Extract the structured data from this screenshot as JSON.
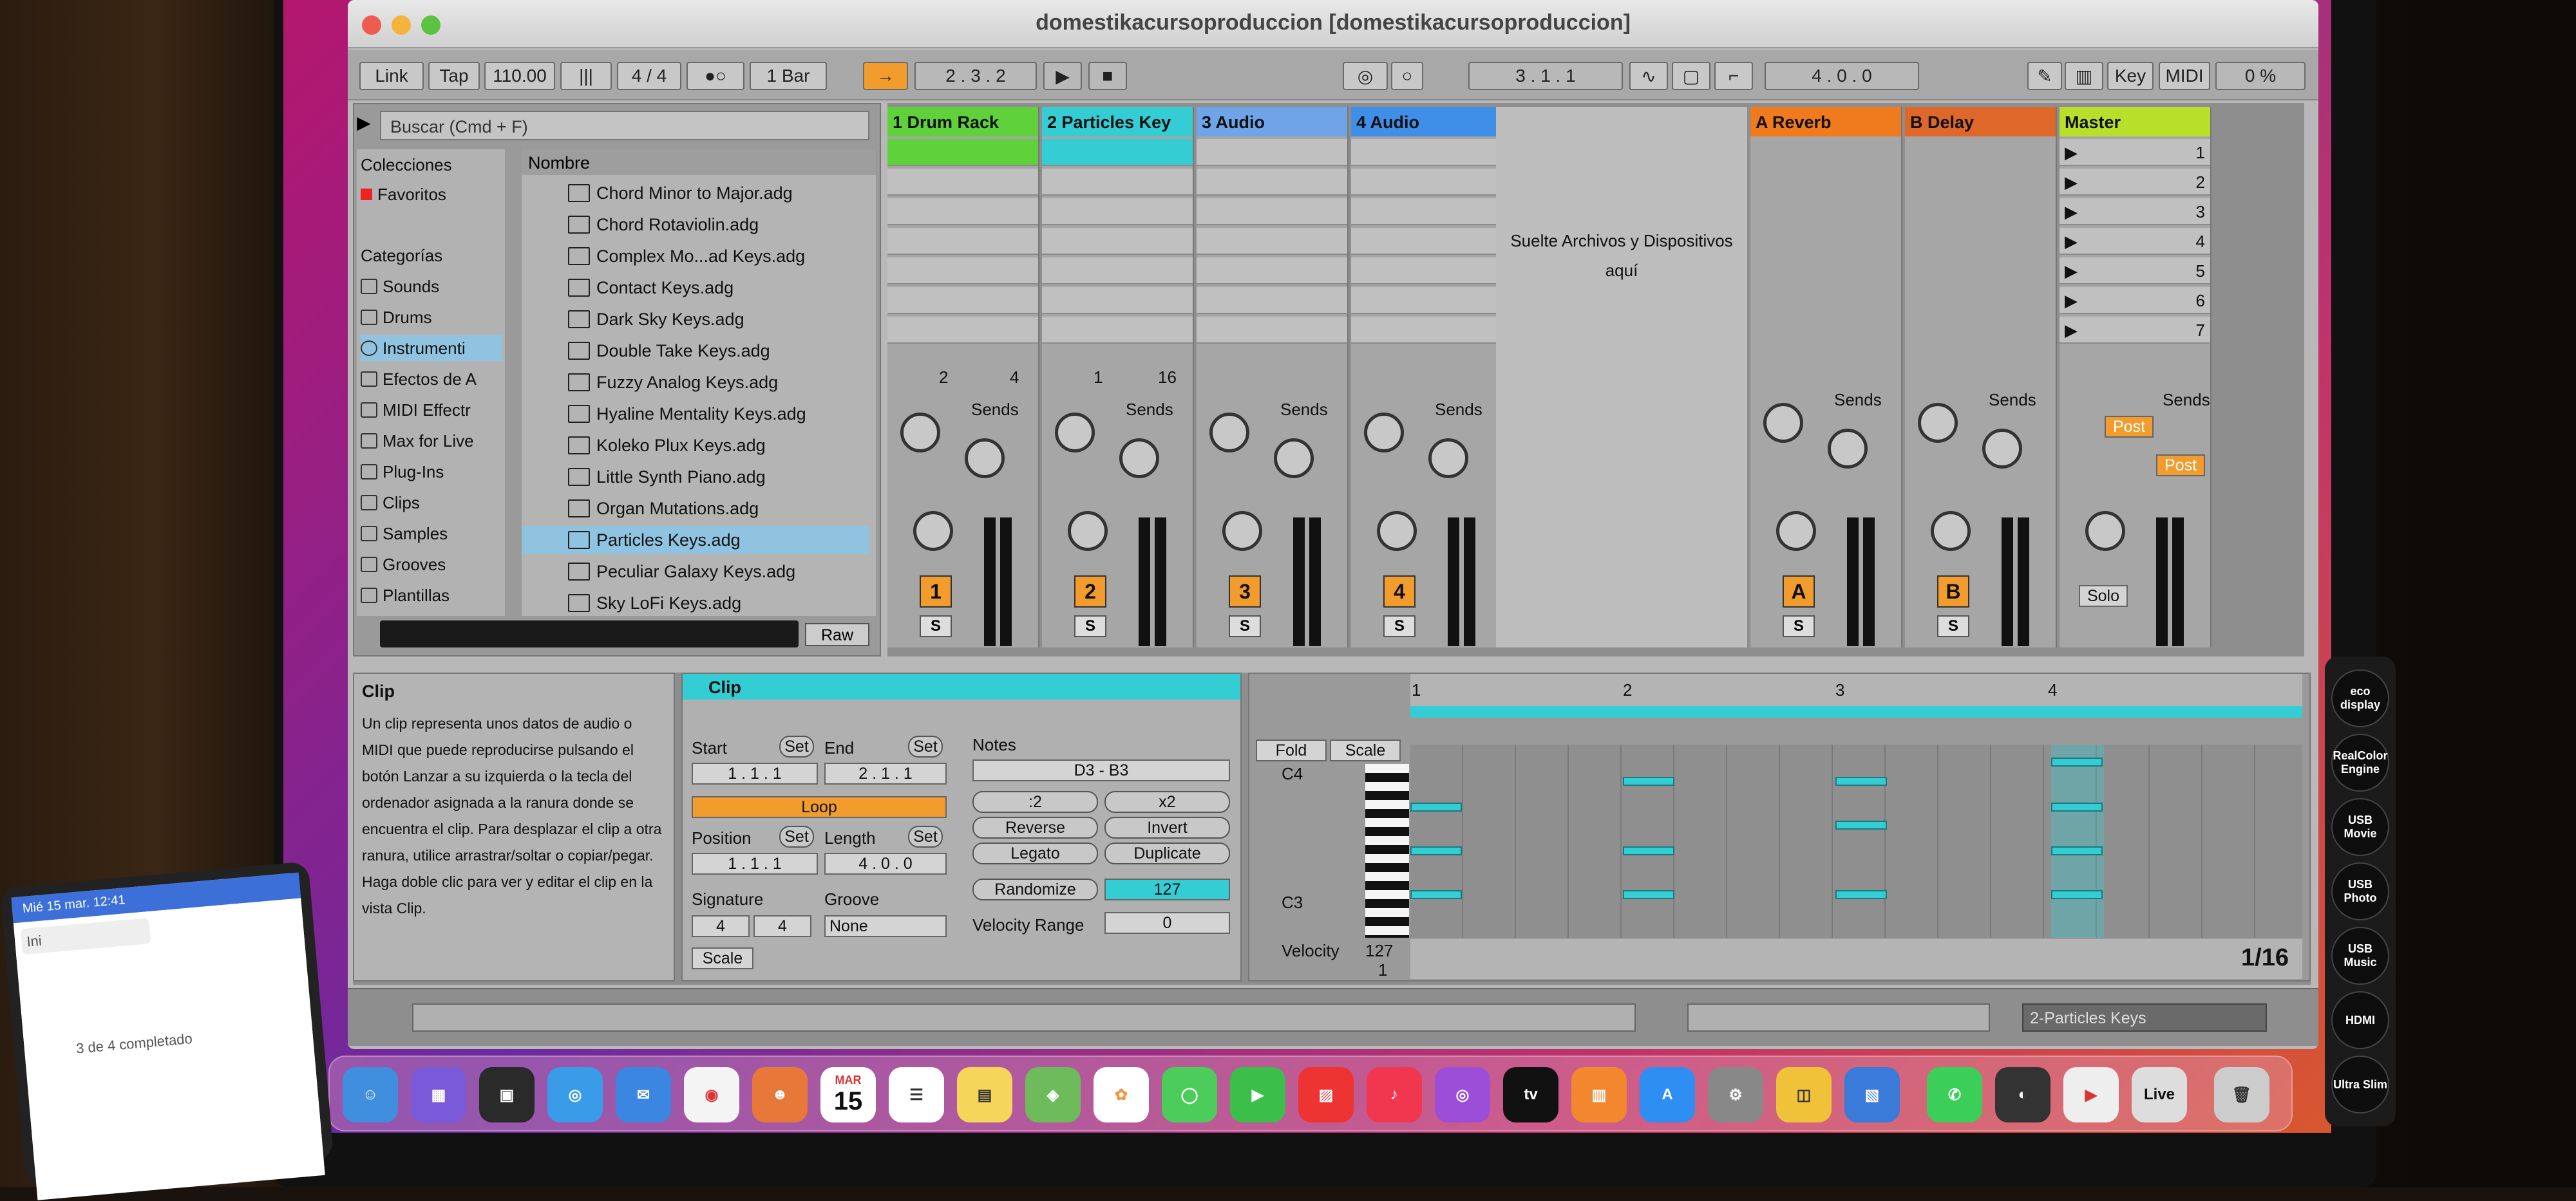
{
  "window": {
    "title": "domestikacursoproduccion  [domestikacursoproduccion]"
  },
  "control_bar": {
    "link": "Link",
    "tap": "Tap",
    "tempo": "110.00",
    "sig": "4 / 4",
    "quant": "1 Bar",
    "pos1": "2 .  3 .  2",
    "pos2": "3 .  1 .  1",
    "pos3": "4 .  0 .  0",
    "key": "Key",
    "midi": "MIDI",
    "cpu": "0 %"
  },
  "browser": {
    "search_placeholder": "Buscar (Cmd + F)",
    "colecciones": "Colecciones",
    "favoritos": "Favoritos",
    "categorias": "Categorías",
    "nombre": "Nombre",
    "raw": "Raw",
    "categories": [
      "Sounds",
      "Drums",
      "Instrumenti",
      "Efectos de A",
      "MIDI Effectr",
      "Max for Live",
      "Plug-Ins",
      "Clips",
      "Samples",
      "Grooves",
      "Plantillas"
    ],
    "items": [
      "Chord Minor to Major.adg",
      "Chord Rotaviolin.adg",
      "Complex Mo...ad Keys.adg",
      "Contact Keys.adg",
      "Dark Sky Keys.adg",
      "Double Take Keys.adg",
      "Fuzzy Analog Keys.adg",
      "Hyaline Mentality Keys.adg",
      "Koleko Plux Keys.adg",
      "Little Synth Piano.adg",
      "Organ Mutations.adg",
      "Particles Keys.adg",
      "Peculiar Galaxy Keys.adg",
      "Sky LoFi Keys.adg"
    ]
  },
  "tracks": [
    {
      "name": "1 Drum Rack",
      "num": "1",
      "color": "#5fd13a",
      "val1": "2",
      "val2": "4"
    },
    {
      "name": "2 Particles Key",
      "num": "2",
      "color": "#35cdd4",
      "val1": "1",
      "val2": "16"
    },
    {
      "name": "3 Audio",
      "num": "3",
      "color": "#6fa4e8"
    },
    {
      "name": "4 Audio",
      "num": "4",
      "color": "#3f8ee8"
    }
  ],
  "returns": [
    {
      "name": "A Reverb",
      "num": "A",
      "color": "#f07a1e"
    },
    {
      "name": "B Delay",
      "num": "B",
      "color": "#e0672a"
    },
    {
      "name": "Master",
      "num": "",
      "color": "#b8e02b"
    }
  ],
  "sends_label": "Sends",
  "post": "Post",
  "solo": "Solo",
  "scene_numbers": [
    "1",
    "2",
    "3",
    "4",
    "5",
    "6",
    "7"
  ],
  "dropzone": "Suelte Archivos y Dispositivos aquí",
  "info": {
    "title": "Clip",
    "body": "Un clip representa unos datos de audio o MIDI que puede reproducirse pulsando el botón Lanzar a su izquierda o la tecla del ordenador asignada a la ranura donde se encuentra el clip. Para desplazar el clip a otra ranura, utilice arrastrar/soltar o copiar/pegar. Haga doble clic para ver y editar el clip en la vista Clip."
  },
  "clip": {
    "title": "Clip",
    "start": "Start",
    "end": "End",
    "set": "Set",
    "start_val": "1 .  1 .  1",
    "end_val": "2 .  1 .  1",
    "loop": "Loop",
    "position": "Position",
    "length": "Length",
    "pos_val": "1 .  1 .  1",
    "len_val": "4 .  0 .  0",
    "signature": "Signature",
    "groove": "Groove",
    "sig1": "4",
    "sig2": "4",
    "groove_val": "None",
    "scale": "Scale",
    "notes": "Notes",
    "notes_range": "D3 - B3",
    "half": ":2",
    "double": "x2",
    "reverse": "Reverse",
    "invert": "Invert",
    "legato": "Legato",
    "duplicate": "Duplicate",
    "randomize": "Randomize",
    "rand_val": "127",
    "vel_range": "Velocity Range",
    "vel_range_val": "0"
  },
  "piano": {
    "fold": "Fold",
    "scale": "Scale",
    "c4": "C4",
    "c3": "C3",
    "bars": [
      "1",
      "2",
      "3",
      "4"
    ],
    "velocity": "Velocity",
    "vmax": "127",
    "vmin": "1",
    "grid": "1/16"
  },
  "status": {
    "track": "2-Particles Keys"
  },
  "dock": {
    "cal_month": "MAR",
    "cal_day": "15",
    "tv": "tv",
    "live": "Live"
  },
  "stickers": [
    "eco display",
    "RealColor Engine",
    "USB Movie",
    "USB Photo",
    "USB Music",
    "HDMI",
    "Ultra Slim"
  ],
  "laptop": {
    "date": "Mié 15 mar.  12:41",
    "tab": "Ini",
    "progress": "3 de 4 completado"
  }
}
